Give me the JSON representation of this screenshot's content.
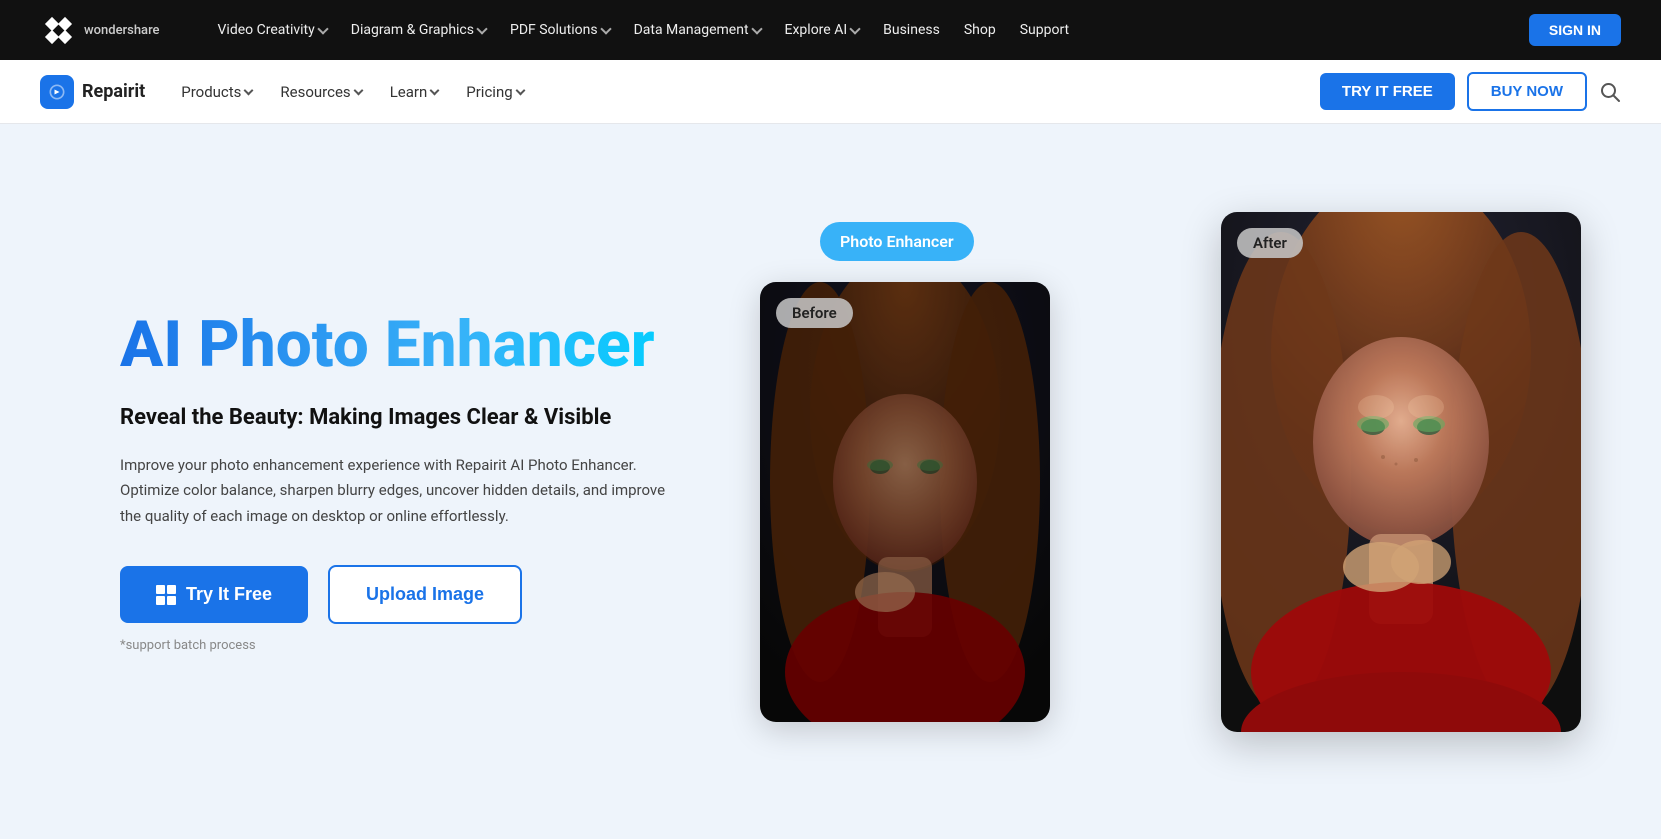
{
  "topbar": {
    "logo_name": "wondershare",
    "nav_items": [
      {
        "label": "Video Creativity",
        "has_dropdown": true
      },
      {
        "label": "Diagram & Graphics",
        "has_dropdown": true
      },
      {
        "label": "PDF Solutions",
        "has_dropdown": true
      },
      {
        "label": "Data Management",
        "has_dropdown": true
      },
      {
        "label": "Explore AI",
        "has_dropdown": true
      },
      {
        "label": "Business",
        "has_dropdown": false
      },
      {
        "label": "Shop",
        "has_dropdown": false
      },
      {
        "label": "Support",
        "has_dropdown": false
      }
    ],
    "signin_label": "SIGN IN"
  },
  "secnav": {
    "product_name": "Repairit",
    "nav_items": [
      {
        "label": "Products",
        "has_dropdown": true
      },
      {
        "label": "Resources",
        "has_dropdown": true
      },
      {
        "label": "Learn",
        "has_dropdown": true
      },
      {
        "label": "Pricing",
        "has_dropdown": true
      }
    ],
    "try_free_label": "TRY IT FREE",
    "buy_now_label": "BUY NOW"
  },
  "hero": {
    "title": "AI Photo Enhancer",
    "subtitle": "Reveal the Beauty: Making Images Clear & Visible",
    "description": "Improve your photo enhancement experience with Repairit AI Photo Enhancer. Optimize color balance, sharpen blurry edges, uncover hidden details, and improve the quality of each image on desktop or online effortlessly.",
    "try_free_label": "Try It Free",
    "upload_label": "Upload Image",
    "note": "*support batch process",
    "before_label": "Before",
    "after_label": "After",
    "bubble_label": "Photo Enhancer"
  }
}
